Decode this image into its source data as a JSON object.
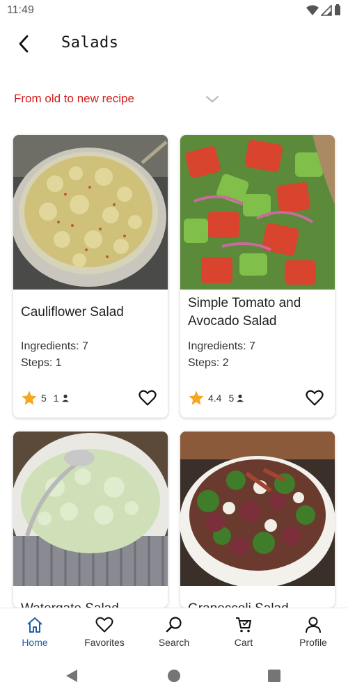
{
  "status_bar": {
    "time": "11:49"
  },
  "header": {
    "title": "Salads",
    "back_icon": "arrow-back-icon"
  },
  "sort": {
    "label": "From old to new recipe",
    "icon": "chevron-down-icon"
  },
  "recipes": [
    {
      "title": "Cauliflower Salad",
      "ingredients": "Ingredients: 7",
      "steps": "Steps: 1",
      "rating": "5",
      "reviews": "1",
      "image": "cauliflower-salad-photo"
    },
    {
      "title": "Simple Tomato and Avocado Salad",
      "ingredients": "Ingredients: 7",
      "steps": "Steps: 2",
      "rating": "4.4",
      "reviews": "5",
      "image": "tomato-avocado-salad-photo"
    },
    {
      "title": "Watergate Salad",
      "image": "watergate-salad-photo"
    },
    {
      "title": "Grapeccoli Salad",
      "image": "grapeccoli-salad-photo"
    }
  ],
  "bottom_nav": [
    {
      "label": "Home",
      "icon": "home-icon",
      "active": true
    },
    {
      "label": "Favorites",
      "icon": "heart-icon",
      "active": false
    },
    {
      "label": "Search",
      "icon": "search-icon",
      "active": false
    },
    {
      "label": "Cart",
      "icon": "cart-icon",
      "active": false
    },
    {
      "label": "Profile",
      "icon": "profile-icon",
      "active": false
    }
  ],
  "colors": {
    "accent": "#1f5fa8",
    "sort_label": "#d21f1f",
    "star": "#f5a623"
  }
}
